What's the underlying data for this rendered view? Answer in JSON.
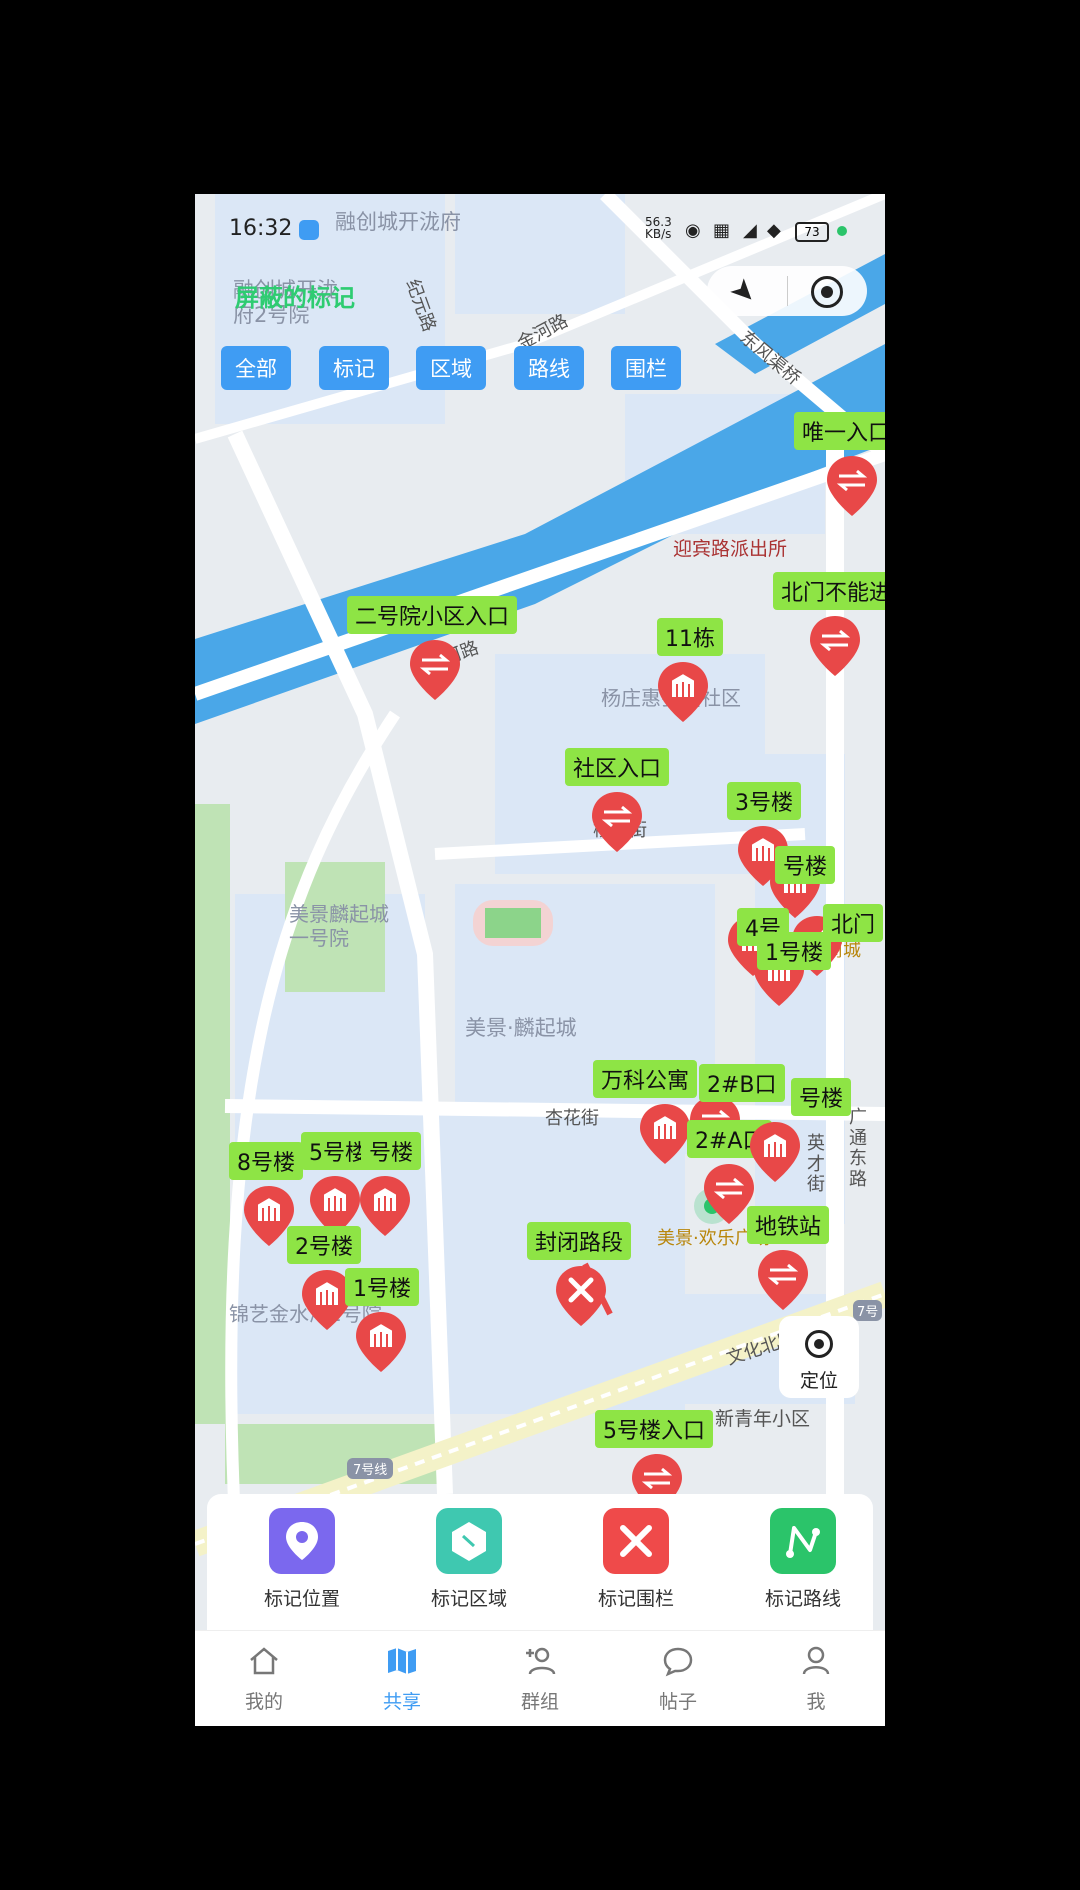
{
  "status_bar": {
    "time": "16:32",
    "net_speed": "56.3 KB/s",
    "battery": "73"
  },
  "shield_label": "屏蔽的标记",
  "filters": [
    "全部",
    "标记",
    "区域",
    "路线",
    "围栏"
  ],
  "map_labels": {
    "top_estate": "融创城开泷府",
    "west_estate": "融创城开泷府2号院",
    "road_jiyuan": "纪元路",
    "road_jinhe": "金河路",
    "road_dongfeng": "东风渠桥",
    "road_jianghe": "江河路",
    "police": "迎宾路派出所",
    "yangzhuang_comm": "杨庄惠弘园社区",
    "yangzhuang_st": "杨庄街",
    "meijing_1": "美景麟起城一号院",
    "meijing": "美景·麟起城",
    "xinghua_st": "杏花街",
    "jinyi": "锦艺金水湾2号院",
    "wenhua_n": "文化北路",
    "xinqingnian": "新青年小区",
    "line7": "7号线",
    "line7b": "7号",
    "guangtong": "广通东路",
    "yingcai": "英才街",
    "huanle": "美景·欢乐广场",
    "shangcheng": "商城"
  },
  "markers": [
    {
      "label": "唯一入口",
      "type": "entrance"
    },
    {
      "label": "北门不能进",
      "type": "entrance"
    },
    {
      "label": "二号院小区入口",
      "type": "entrance"
    },
    {
      "label": "11栋",
      "type": "building"
    },
    {
      "label": "社区入口",
      "type": "entrance"
    },
    {
      "label": "3号楼",
      "type": "building"
    },
    {
      "label": "号楼",
      "type": "building"
    },
    {
      "label": "4号",
      "type": "building"
    },
    {
      "label": "北门",
      "type": "entrance"
    },
    {
      "label": "1号楼",
      "type": "building"
    },
    {
      "label": "万科公寓",
      "type": "building"
    },
    {
      "label": "2#B口",
      "type": "entrance"
    },
    {
      "label": "2#A口",
      "type": "entrance"
    },
    {
      "label": "号楼",
      "type": "building"
    },
    {
      "label": "地铁站",
      "type": "entrance"
    },
    {
      "label": "8号楼",
      "type": "building"
    },
    {
      "label": "5号楼",
      "type": "building"
    },
    {
      "label": "号楼",
      "type": "building"
    },
    {
      "label": "2号楼",
      "type": "building"
    },
    {
      "label": "1号楼",
      "type": "building"
    },
    {
      "label": "封闭路段",
      "type": "closed"
    },
    {
      "label": "5号楼入口",
      "type": "entrance"
    }
  ],
  "locate_button": "定位",
  "actions": [
    {
      "label": "标记位置",
      "color": "#7b68ee"
    },
    {
      "label": "标记区域",
      "color": "#3fc8b0"
    },
    {
      "label": "标记围栏",
      "color": "#ef4a4a"
    },
    {
      "label": "标记路线",
      "color": "#2bc46a"
    }
  ],
  "bottom_nav": [
    {
      "label": "我的",
      "icon": "home-icon",
      "active": false
    },
    {
      "label": "共享",
      "icon": "map-icon",
      "active": true
    },
    {
      "label": "群组",
      "icon": "add-user-icon",
      "active": false
    },
    {
      "label": "帖子",
      "icon": "chat-icon",
      "active": false
    },
    {
      "label": "我",
      "icon": "person-icon",
      "active": false
    }
  ],
  "colors": {
    "accent": "#3f9cf3",
    "marker": "#e84848",
    "label_bg": "#8ee445",
    "water": "#4aa7e8"
  }
}
